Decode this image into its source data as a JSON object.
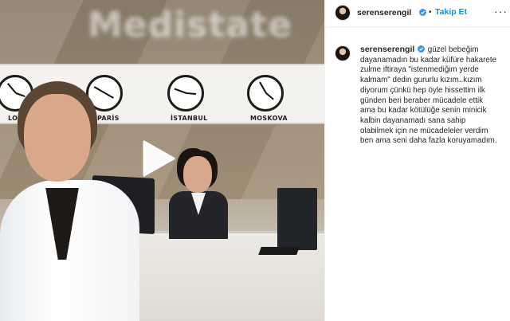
{
  "video": {
    "clocks": [
      {
        "label": "LO"
      },
      {
        "label": "PARİS"
      },
      {
        "label": "İSTANBUL"
      },
      {
        "label": "MOSKOVA"
      }
    ],
    "play_icon": "play-icon",
    "logo_text": "Medistate"
  },
  "post": {
    "username": "serenserengil",
    "verified_icon": "verified-badge-icon",
    "separator": "•",
    "follow_label": "Takip Et",
    "more_icon": "more-options-icon",
    "more_label": "···"
  },
  "comment": {
    "username": "serenserengil",
    "caption_lines": [
      "güzel bebeğim",
      "dayanamadın bu kadar küfüre hakarete",
      "zulme iftiraya \"istenmediğim yerde",
      "kalmam\" dedin gururlu kızım..kızım",
      "diyorum çünkü hep öyle hissettim ilk",
      "günden beri beraber mücadele ettik",
      "ama bu kadar kötülüğe senin minicik",
      "kalbin dayanamadı sana sahip",
      "olabilmek için ne mücadeleler verdim",
      "ben ama seni daha fazla koruyamadım."
    ]
  },
  "colors": {
    "accent": "#0095f6",
    "text": "#262626",
    "border": "#efefef"
  }
}
